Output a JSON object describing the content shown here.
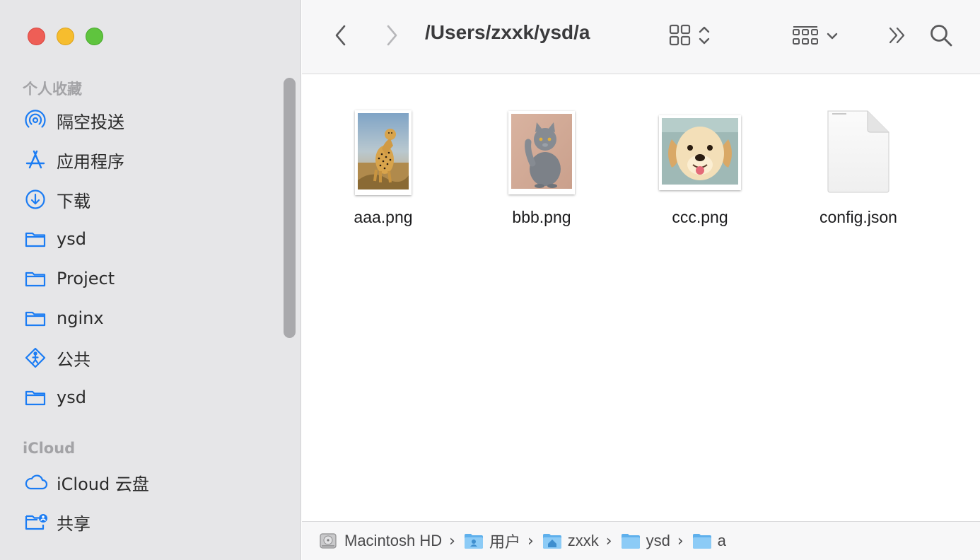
{
  "toolbar": {
    "path_title": "/Users/zxxk/ysd/a"
  },
  "sidebar": {
    "favorites_heading": "个人收藏",
    "favorites": [
      {
        "label": "隔空投送",
        "icon": "airdrop-icon"
      },
      {
        "label": "应用程序",
        "icon": "applications-icon"
      },
      {
        "label": "下载",
        "icon": "downloads-icon"
      },
      {
        "label": "ysd",
        "icon": "folder-icon"
      },
      {
        "label": "Project",
        "icon": "folder-icon"
      },
      {
        "label": "nginx",
        "icon": "folder-icon"
      },
      {
        "label": "公共",
        "icon": "public-icon"
      },
      {
        "label": "ysd",
        "icon": "folder-icon"
      }
    ],
    "icloud_heading": "iCloud",
    "icloud": [
      {
        "label": "iCloud 云盘",
        "icon": "icloud-icon"
      },
      {
        "label": "共享",
        "icon": "shared-folder-icon"
      }
    ]
  },
  "files": [
    {
      "name": "aaa.png",
      "kind": "image",
      "icon": "cheetah-thumbnail"
    },
    {
      "name": "bbb.png",
      "kind": "image",
      "icon": "cat-thumbnail"
    },
    {
      "name": "ccc.png",
      "kind": "image",
      "icon": "puppy-thumbnail"
    },
    {
      "name": "config.json",
      "kind": "document",
      "icon": "document-icon"
    }
  ],
  "pathbar": [
    {
      "label": "Macintosh HD",
      "icon": "hard-drive-icon"
    },
    {
      "label": "用户",
      "icon": "users-folder-icon"
    },
    {
      "label": "zxxk",
      "icon": "home-folder-icon"
    },
    {
      "label": "ysd",
      "icon": "folder-icon"
    },
    {
      "label": "a",
      "icon": "folder-icon"
    }
  ],
  "colors": {
    "accent": "#1b7cf3",
    "sidebar_bg": "#e6e6e8",
    "toolbar_bg": "#f7f7f8"
  }
}
